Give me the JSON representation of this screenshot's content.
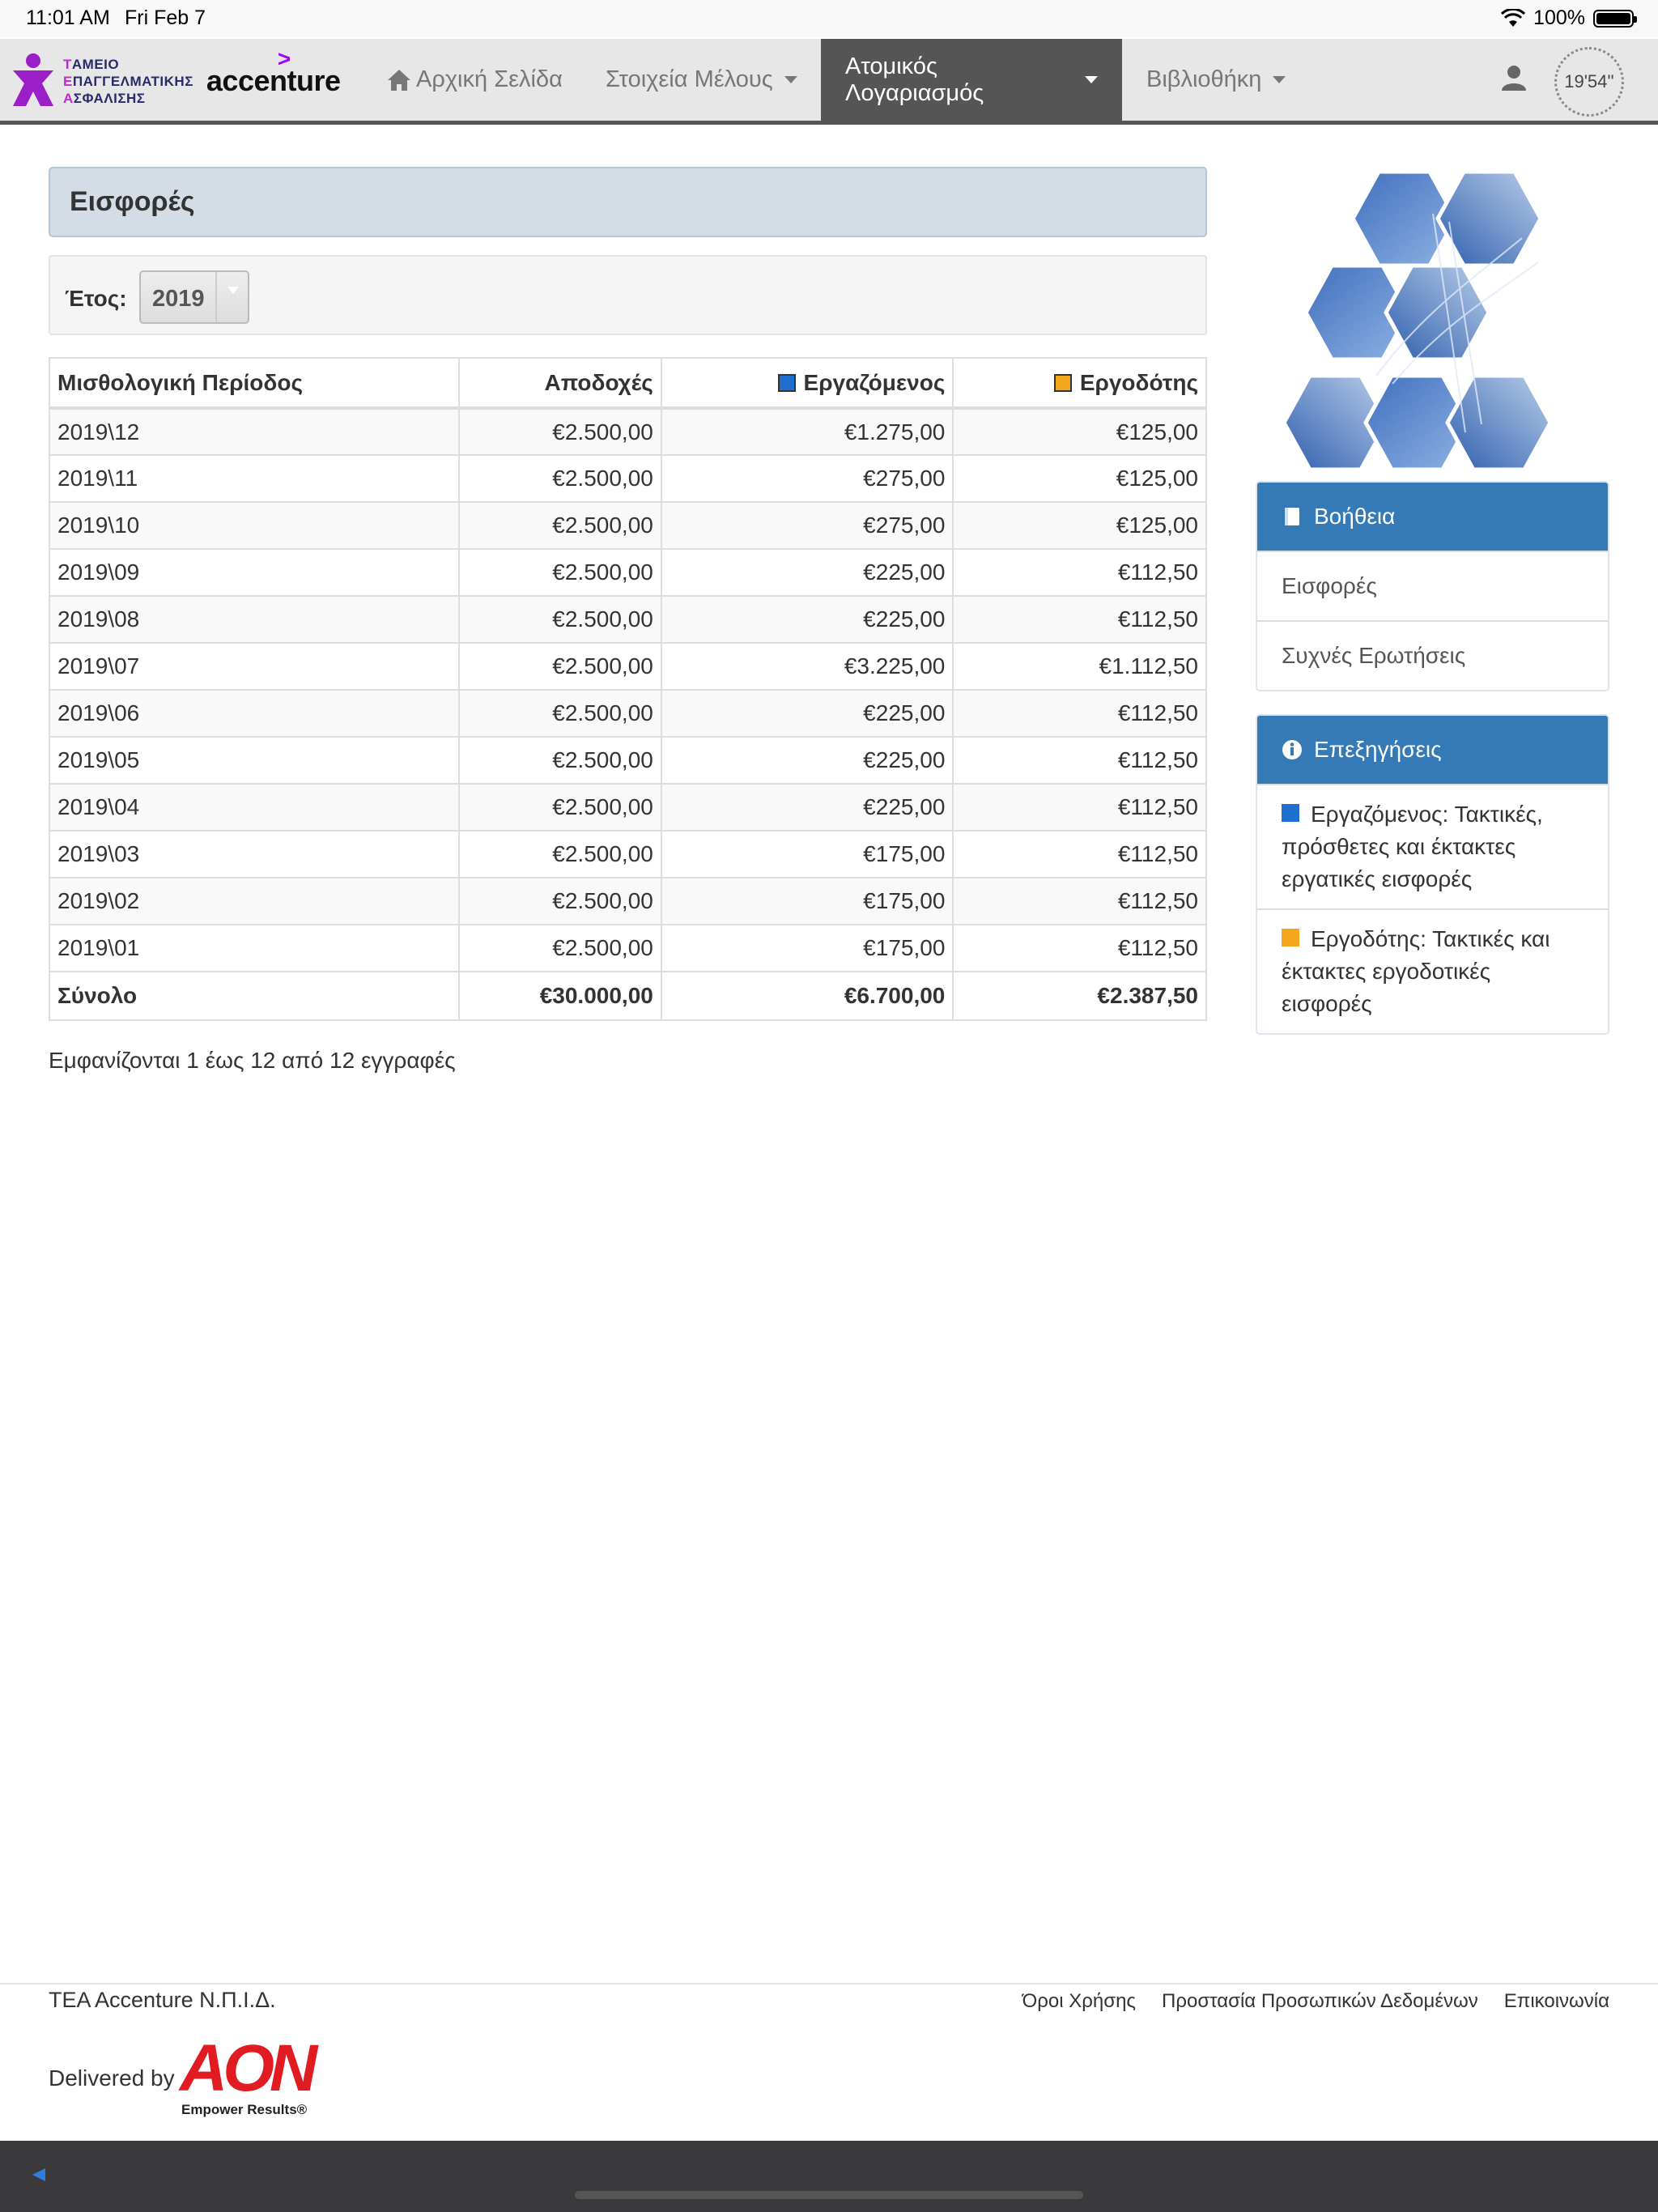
{
  "status_bar": {
    "time": "11:01 AM",
    "date": "Fri Feb 7",
    "battery": "100%"
  },
  "brand": {
    "tea_lines": [
      {
        "initial": "T",
        "rest": "ΑΜΕΙΟ"
      },
      {
        "initial": "Ε",
        "rest": "ΠΑΓΓΕΛΜΑΤΙΚΗΣ"
      },
      {
        "initial": "Α",
        "rest": "ΣΦΑΛΙΣΗΣ"
      }
    ],
    "partner": "accenture",
    "partner_accent": ">"
  },
  "nav": {
    "home": "Αρχική Σελίδα",
    "member": "Στοιχεία Μέλους",
    "account": "Ατομικός Λογαριασμός",
    "library": "Βιβλιοθήκη",
    "timer": "19'54''"
  },
  "page": {
    "title": "Εισφορές",
    "year_label": "Έτος:",
    "year_value": "2019"
  },
  "table": {
    "headers": {
      "period": "Μισθολογική Περίοδος",
      "earnings": "Αποδοχές",
      "employee": "Εργαζόμενος",
      "employer": "Εργοδότης"
    },
    "rows": [
      {
        "period": "2019\\12",
        "earnings": "€2.500,00",
        "employee": "€1.275,00",
        "employer": "€125,00"
      },
      {
        "period": "2019\\11",
        "earnings": "€2.500,00",
        "employee": "€275,00",
        "employer": "€125,00"
      },
      {
        "period": "2019\\10",
        "earnings": "€2.500,00",
        "employee": "€275,00",
        "employer": "€125,00"
      },
      {
        "period": "2019\\09",
        "earnings": "€2.500,00",
        "employee": "€225,00",
        "employer": "€112,50"
      },
      {
        "period": "2019\\08",
        "earnings": "€2.500,00",
        "employee": "€225,00",
        "employer": "€112,50"
      },
      {
        "period": "2019\\07",
        "earnings": "€2.500,00",
        "employee": "€3.225,00",
        "employer": "€1.112,50"
      },
      {
        "period": "2019\\06",
        "earnings": "€2.500,00",
        "employee": "€225,00",
        "employer": "€112,50"
      },
      {
        "period": "2019\\05",
        "earnings": "€2.500,00",
        "employee": "€225,00",
        "employer": "€112,50"
      },
      {
        "period": "2019\\04",
        "earnings": "€2.500,00",
        "employee": "€225,00",
        "employer": "€112,50"
      },
      {
        "period": "2019\\03",
        "earnings": "€2.500,00",
        "employee": "€175,00",
        "employer": "€112,50"
      },
      {
        "period": "2019\\02",
        "earnings": "€2.500,00",
        "employee": "€175,00",
        "employer": "€112,50"
      },
      {
        "period": "2019\\01",
        "earnings": "€2.500,00",
        "employee": "€175,00",
        "employer": "€112,50"
      }
    ],
    "total": {
      "label": "Σύνολο",
      "earnings": "€30.000,00",
      "employee": "€6.700,00",
      "employer": "€2.387,50"
    },
    "records_info": "Εμφανίζονται 1 έως 12 από 12 εγγραφές"
  },
  "sidebar": {
    "help": {
      "title": "Βοήθεια",
      "links": [
        "Εισφορές",
        "Συχνές Ερωτήσεις"
      ]
    },
    "explanations": {
      "title": "Επεξηγήσεις",
      "employee": "Εργαζόμενος: Τακτικές, πρόσθετες και έκτακτες εργατικές εισφορές",
      "employer": "Εργοδότης: Τακτικές και έκτακτες εργοδοτικές εισφορές"
    }
  },
  "footer": {
    "company": "TEA Accenture Ν.Π.Ι.Δ.",
    "links": [
      "Όροι Χρήσης",
      "Προστασία Προσωπικών Δεδομένων",
      "Επικοινωνία"
    ],
    "delivered_by": "Delivered by",
    "aon_logo": "AON",
    "aon_tagline": "Empower Results®"
  },
  "colors": {
    "employee": "#1f6fd0",
    "employer": "#f4a71c",
    "header_blue": "#337ab7",
    "nav_active": "#555555",
    "brand_purple": "#a100ff"
  }
}
